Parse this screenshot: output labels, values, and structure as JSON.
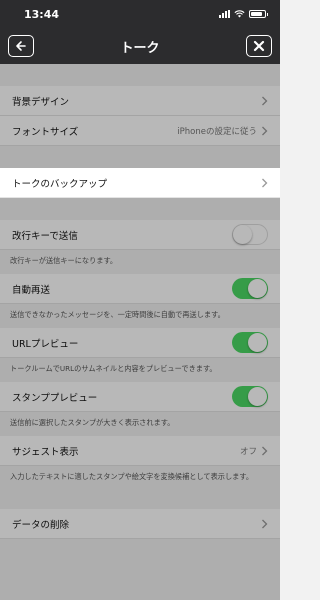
{
  "status": {
    "time": "13:44",
    "battery_level": 0.85
  },
  "nav": {
    "title": "トーク",
    "back_icon": "back-arrow-icon",
    "close_icon": "close-icon"
  },
  "settings": {
    "background_design": {
      "label": "背景デザイン"
    },
    "font_size": {
      "label": "フォントサイズ",
      "value": "iPhoneの設定に従う"
    },
    "backup": {
      "label": "トークのバックアップ"
    },
    "enter_to_send": {
      "label": "改行キーで送信",
      "enabled": false,
      "description": "改行キーが送信キーになります。"
    },
    "auto_resend": {
      "label": "自動再送",
      "enabled": true,
      "description": "送信できなかったメッセージを、一定時間後に自動で再送します。"
    },
    "url_preview": {
      "label": "URLプレビュー",
      "enabled": true,
      "description": "トークルームでURLのサムネイルと内容をプレビューできます。"
    },
    "sticker_preview": {
      "label": "スタンププレビュー",
      "enabled": true,
      "description": "送信前に選択したスタンプが大きく表示されます。"
    },
    "suggest": {
      "label": "サジェスト表示",
      "value": "オフ",
      "description": "入力したテキストに適したスタンプや絵文字を変換候補として表示します。"
    },
    "delete_data": {
      "label": "データの削除"
    }
  },
  "colors": {
    "toggle_on": "#4cd964",
    "nav_bg": "#2c2c2e"
  }
}
